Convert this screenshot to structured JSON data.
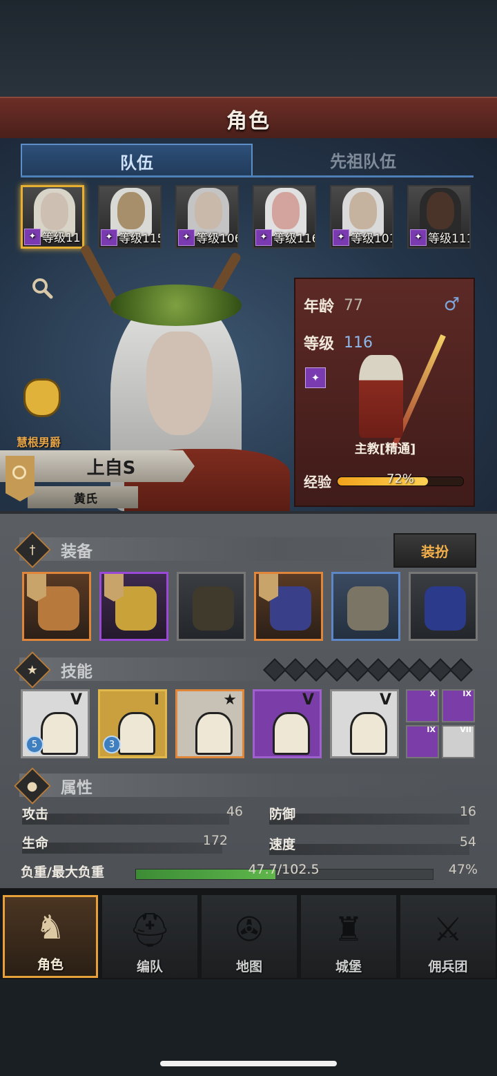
{
  "header": {
    "title": "角色"
  },
  "tabs": [
    {
      "label": "队伍",
      "active": true
    },
    {
      "label": "先祖队伍",
      "active": false
    }
  ],
  "party": [
    {
      "level_label": "等级11",
      "active": true,
      "hair": "#d8d4c8",
      "skin": "#cdbfb2"
    },
    {
      "level_label": "等级115",
      "active": false,
      "hair": "#d9d9d6",
      "skin": "#a88f6c"
    },
    {
      "level_label": "等级106",
      "active": false,
      "hair": "#c4c4c4",
      "skin": "#c8b9ab"
    },
    {
      "level_label": "等级116",
      "active": false,
      "hair": "#e0e0e0",
      "skin": "#d3a49e"
    },
    {
      "level_label": "等级101",
      "active": false,
      "hair": "#dadada",
      "skin": "#c5b39f"
    },
    {
      "level_label": "等级111",
      "active": false,
      "hair": "#2a2a2a",
      "skin": "#4a3329"
    }
  ],
  "character": {
    "title": "慧根男爵",
    "name": "上自S",
    "clan": "黄氏",
    "age_label": "年龄",
    "age": "77",
    "level_label": "等级",
    "level": "116",
    "gender_icon": "♂",
    "class_name": "主教[精通]",
    "exp_label": "经验",
    "exp_percent": 72,
    "exp_text": "72%"
  },
  "equipment": {
    "section_label": "装备",
    "dress_button": "装扮",
    "slots": [
      {
        "rarity": "orange",
        "marked": true,
        "color": "#b87a3c"
      },
      {
        "rarity": "purple",
        "marked": true,
        "color": "#c9a23a"
      },
      {
        "rarity": "gray",
        "marked": false,
        "color": "#3f3a2c"
      },
      {
        "rarity": "orange",
        "marked": true,
        "color": "#3a3f8a"
      },
      {
        "rarity": "blue",
        "marked": false,
        "color": "#7b7566"
      },
      {
        "rarity": "gray",
        "marked": false,
        "color": "#2b3a8a"
      }
    ]
  },
  "skills": {
    "section_label": "技能",
    "gem_count": 10,
    "main": [
      {
        "style": "plain",
        "roman": "V",
        "level": "5"
      },
      {
        "style": "gold",
        "roman": "I",
        "level": "3"
      },
      {
        "style": "orangeb",
        "roman": "★",
        "level": ""
      },
      {
        "style": "purp",
        "roman": "V",
        "level": ""
      },
      {
        "style": "plain",
        "roman": "V",
        "level": ""
      }
    ],
    "mini": [
      {
        "roman": "X",
        "bg": "#7b3da8"
      },
      {
        "roman": "IX",
        "bg": "#7b3da8"
      },
      {
        "roman": "IX",
        "bg": "#7b3da8"
      },
      {
        "roman": "VII",
        "bg": "#cfcfcf"
      }
    ]
  },
  "attributes": {
    "section_label": "属性",
    "attack_label": "攻击",
    "attack": "46",
    "defense_label": "防御",
    "defense": "16",
    "hp_label": "生命",
    "hp": "172",
    "speed_label": "速度",
    "speed": "54",
    "load_label": "负重/最大负重",
    "load_text": "47.7/102.5",
    "load_percent": 47,
    "load_pct_text": "47%"
  },
  "nav": [
    {
      "label": "角色",
      "active": true,
      "icon": "knight-icon"
    },
    {
      "label": "编队",
      "active": false,
      "icon": "helmet-icon"
    },
    {
      "label": "地图",
      "active": false,
      "icon": "compass-map-icon"
    },
    {
      "label": "城堡",
      "active": false,
      "icon": "castle-icon"
    },
    {
      "label": "佣兵团",
      "active": false,
      "icon": "mercenary-icon"
    }
  ]
}
